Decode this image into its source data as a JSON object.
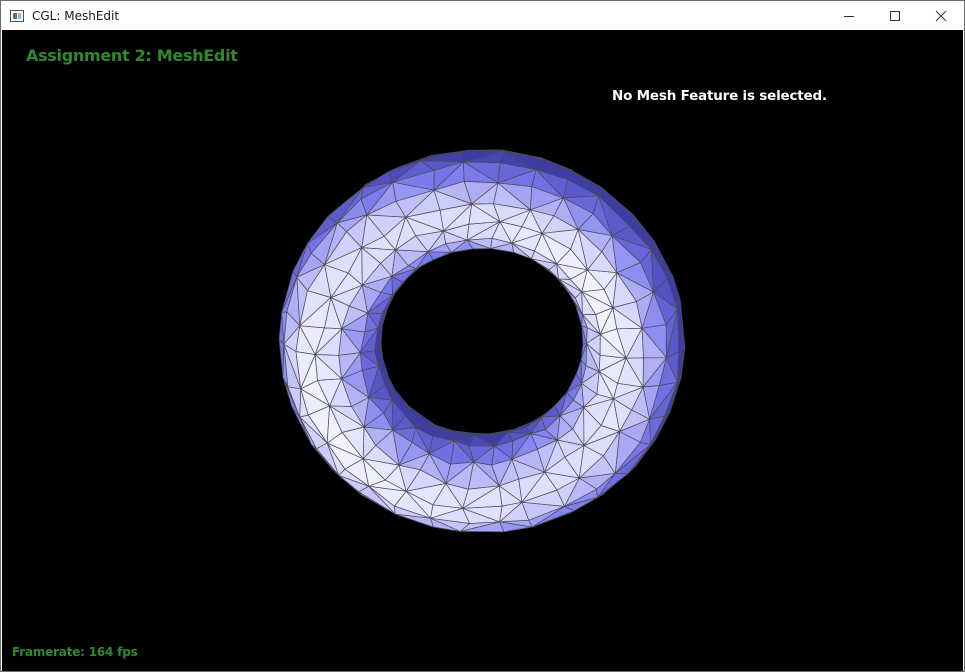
{
  "window": {
    "title": "CGL: MeshEdit",
    "controls": {
      "minimize_icon": "minimize-icon",
      "maximize_icon": "maximize-icon",
      "close_icon": "close-icon"
    }
  },
  "hud": {
    "assignment_title": "Assignment 2: MeshEdit",
    "selection_status": "No Mesh Feature is selected.",
    "framerate": "Framerate: 164 fps"
  },
  "scene": {
    "object": "torus-mesh",
    "background_color": "#000000",
    "mesh_face_color": "#e8e8ff",
    "mesh_shadow_color": "#7b7bf0",
    "mesh_edge_color": "#4a4a55",
    "hud_accent_color": "#2f8a2f"
  }
}
